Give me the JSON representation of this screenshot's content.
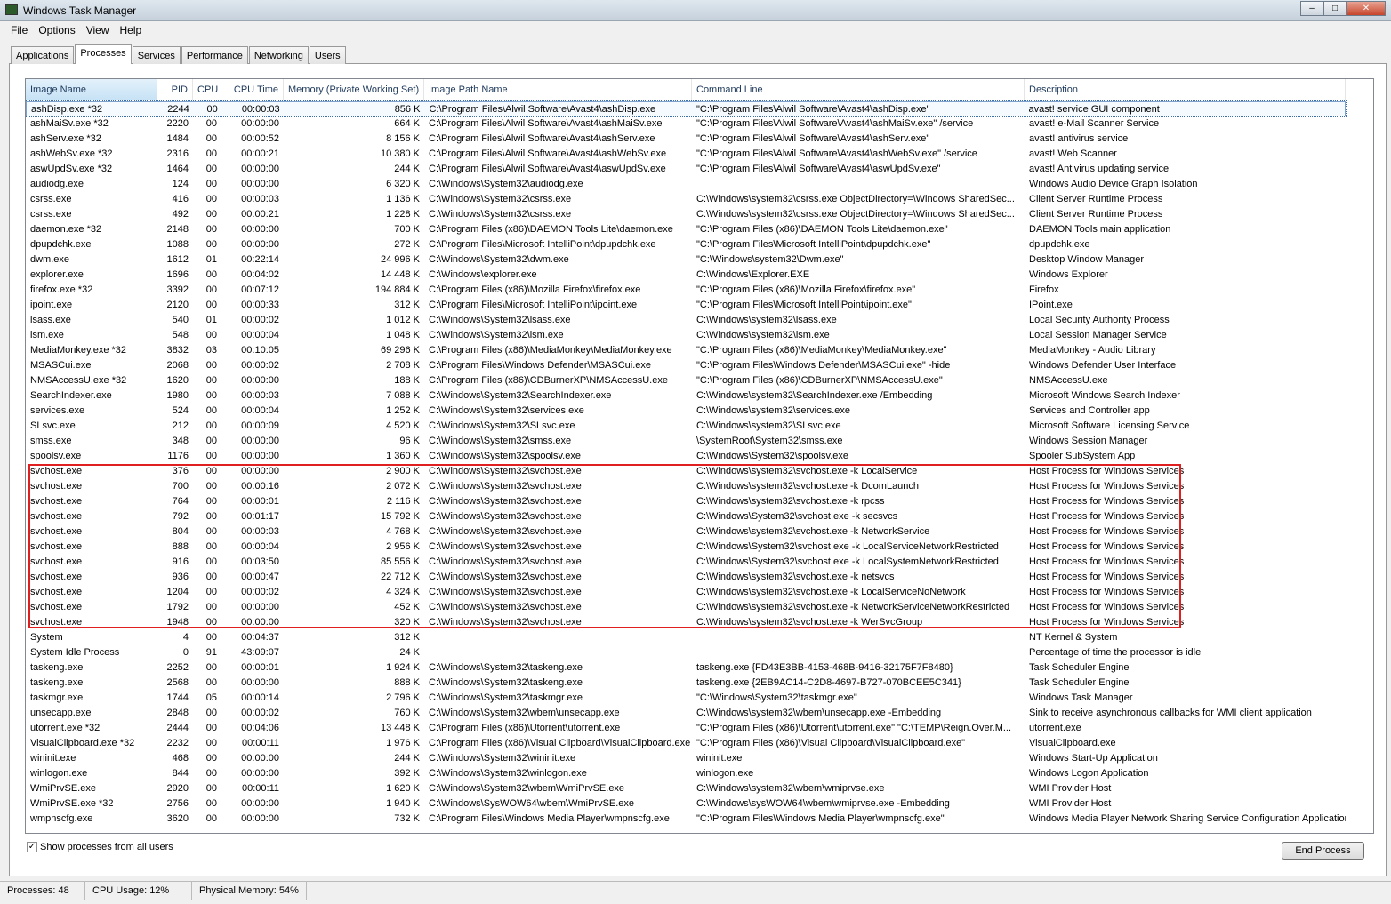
{
  "window": {
    "title": "Windows Task Manager"
  },
  "menu": [
    "File",
    "Options",
    "View",
    "Help"
  ],
  "tabs": [
    "Applications",
    "Processes",
    "Services",
    "Performance",
    "Networking",
    "Users"
  ],
  "columns": [
    "Image Name",
    "PID",
    "CPU",
    "CPU Time",
    "Memory (Private Working Set)",
    "Image Path Name",
    "Command Line",
    "Description"
  ],
  "rows": [
    [
      "ashDisp.exe *32",
      "2244",
      "00",
      "00:00:03",
      "856 K",
      "C:\\Program Files\\Alwil Software\\Avast4\\ashDisp.exe",
      "\"C:\\Program Files\\Alwil Software\\Avast4\\ashDisp.exe\"",
      "avast! service GUI component"
    ],
    [
      "ashMaiSv.exe *32",
      "2220",
      "00",
      "00:00:00",
      "664 K",
      "C:\\Program Files\\Alwil Software\\Avast4\\ashMaiSv.exe",
      "\"C:\\Program Files\\Alwil Software\\Avast4\\ashMaiSv.exe\" /service",
      "avast! e-Mail Scanner Service"
    ],
    [
      "ashServ.exe *32",
      "1484",
      "00",
      "00:00:52",
      "8 156 K",
      "C:\\Program Files\\Alwil Software\\Avast4\\ashServ.exe",
      "\"C:\\Program Files\\Alwil Software\\Avast4\\ashServ.exe\"",
      "avast! antivirus service"
    ],
    [
      "ashWebSv.exe *32",
      "2316",
      "00",
      "00:00:21",
      "10 380 K",
      "C:\\Program Files\\Alwil Software\\Avast4\\ashWebSv.exe",
      "\"C:\\Program Files\\Alwil Software\\Avast4\\ashWebSv.exe\" /service",
      "avast! Web Scanner"
    ],
    [
      "aswUpdSv.exe *32",
      "1464",
      "00",
      "00:00:00",
      "244 K",
      "C:\\Program Files\\Alwil Software\\Avast4\\aswUpdSv.exe",
      "\"C:\\Program Files\\Alwil Software\\Avast4\\aswUpdSv.exe\"",
      "avast! Antivirus updating service"
    ],
    [
      "audiodg.exe",
      "124",
      "00",
      "00:00:00",
      "6 320 K",
      "C:\\Windows\\System32\\audiodg.exe",
      "",
      "Windows Audio Device Graph Isolation"
    ],
    [
      "csrss.exe",
      "416",
      "00",
      "00:00:03",
      "1 136 K",
      "C:\\Windows\\System32\\csrss.exe",
      "C:\\Windows\\system32\\csrss.exe ObjectDirectory=\\Windows SharedSec...",
      "Client Server Runtime Process"
    ],
    [
      "csrss.exe",
      "492",
      "00",
      "00:00:21",
      "1 228 K",
      "C:\\Windows\\System32\\csrss.exe",
      "C:\\Windows\\system32\\csrss.exe ObjectDirectory=\\Windows SharedSec...",
      "Client Server Runtime Process"
    ],
    [
      "daemon.exe *32",
      "2148",
      "00",
      "00:00:00",
      "700 K",
      "C:\\Program Files (x86)\\DAEMON Tools Lite\\daemon.exe",
      "\"C:\\Program Files (x86)\\DAEMON Tools Lite\\daemon.exe\"",
      "DAEMON Tools main application"
    ],
    [
      "dpupdchk.exe",
      "1088",
      "00",
      "00:00:00",
      "272 K",
      "C:\\Program Files\\Microsoft IntelliPoint\\dpupdchk.exe",
      "\"C:\\Program Files\\Microsoft IntelliPoint\\dpupdchk.exe\"",
      "dpupdchk.exe"
    ],
    [
      "dwm.exe",
      "1612",
      "01",
      "00:22:14",
      "24 996 K",
      "C:\\Windows\\System32\\dwm.exe",
      "\"C:\\Windows\\system32\\Dwm.exe\"",
      "Desktop Window Manager"
    ],
    [
      "explorer.exe",
      "1696",
      "00",
      "00:04:02",
      "14 448 K",
      "C:\\Windows\\explorer.exe",
      "C:\\Windows\\Explorer.EXE",
      "Windows Explorer"
    ],
    [
      "firefox.exe *32",
      "3392",
      "00",
      "00:07:12",
      "194 884 K",
      "C:\\Program Files (x86)\\Mozilla Firefox\\firefox.exe",
      "\"C:\\Program Files (x86)\\Mozilla Firefox\\firefox.exe\"",
      "Firefox"
    ],
    [
      "ipoint.exe",
      "2120",
      "00",
      "00:00:33",
      "312 K",
      "C:\\Program Files\\Microsoft IntelliPoint\\ipoint.exe",
      "\"C:\\Program Files\\Microsoft IntelliPoint\\ipoint.exe\"",
      "IPoint.exe"
    ],
    [
      "lsass.exe",
      "540",
      "01",
      "00:00:02",
      "1 012 K",
      "C:\\Windows\\System32\\lsass.exe",
      "C:\\Windows\\system32\\lsass.exe",
      "Local Security Authority Process"
    ],
    [
      "lsm.exe",
      "548",
      "00",
      "00:00:04",
      "1 048 K",
      "C:\\Windows\\System32\\lsm.exe",
      "C:\\Windows\\system32\\lsm.exe",
      "Local Session Manager Service"
    ],
    [
      "MediaMonkey.exe *32",
      "3832",
      "03",
      "00:10:05",
      "69 296 K",
      "C:\\Program Files (x86)\\MediaMonkey\\MediaMonkey.exe",
      "\"C:\\Program Files (x86)\\MediaMonkey\\MediaMonkey.exe\"",
      "MediaMonkey - Audio Library"
    ],
    [
      "MSASCui.exe",
      "2068",
      "00",
      "00:00:02",
      "2 708 K",
      "C:\\Program Files\\Windows Defender\\MSASCui.exe",
      "\"C:\\Program Files\\Windows Defender\\MSASCui.exe\" -hide",
      "Windows Defender User Interface"
    ],
    [
      "NMSAccessU.exe *32",
      "1620",
      "00",
      "00:00:00",
      "188 K",
      "C:\\Program Files (x86)\\CDBurnerXP\\NMSAccessU.exe",
      "\"C:\\Program Files (x86)\\CDBurnerXP\\NMSAccessU.exe\"",
      "NMSAccessU.exe"
    ],
    [
      "SearchIndexer.exe",
      "1980",
      "00",
      "00:00:03",
      "7 088 K",
      "C:\\Windows\\System32\\SearchIndexer.exe",
      "C:\\Windows\\system32\\SearchIndexer.exe /Embedding",
      "Microsoft Windows Search Indexer"
    ],
    [
      "services.exe",
      "524",
      "00",
      "00:00:04",
      "1 252 K",
      "C:\\Windows\\System32\\services.exe",
      "C:\\Windows\\system32\\services.exe",
      "Services and Controller app"
    ],
    [
      "SLsvc.exe",
      "212",
      "00",
      "00:00:09",
      "4 520 K",
      "C:\\Windows\\System32\\SLsvc.exe",
      "C:\\Windows\\system32\\SLsvc.exe",
      "Microsoft Software Licensing Service"
    ],
    [
      "smss.exe",
      "348",
      "00",
      "00:00:00",
      "96 K",
      "C:\\Windows\\System32\\smss.exe",
      "\\SystemRoot\\System32\\smss.exe",
      "Windows Session Manager"
    ],
    [
      "spoolsv.exe",
      "1176",
      "00",
      "00:00:00",
      "1 360 K",
      "C:\\Windows\\System32\\spoolsv.exe",
      "C:\\Windows\\System32\\spoolsv.exe",
      "Spooler SubSystem App"
    ],
    [
      "svchost.exe",
      "376",
      "00",
      "00:00:00",
      "2 900 K",
      "C:\\Windows\\System32\\svchost.exe",
      "C:\\Windows\\system32\\svchost.exe -k LocalService",
      "Host Process for Windows Services"
    ],
    [
      "svchost.exe",
      "700",
      "00",
      "00:00:16",
      "2 072 K",
      "C:\\Windows\\System32\\svchost.exe",
      "C:\\Windows\\system32\\svchost.exe -k DcomLaunch",
      "Host Process for Windows Services"
    ],
    [
      "svchost.exe",
      "764",
      "00",
      "00:00:01",
      "2 116 K",
      "C:\\Windows\\System32\\svchost.exe",
      "C:\\Windows\\system32\\svchost.exe -k rpcss",
      "Host Process for Windows Services"
    ],
    [
      "svchost.exe",
      "792",
      "00",
      "00:01:17",
      "15 792 K",
      "C:\\Windows\\System32\\svchost.exe",
      "C:\\Windows\\System32\\svchost.exe -k secsvcs",
      "Host Process for Windows Services"
    ],
    [
      "svchost.exe",
      "804",
      "00",
      "00:00:03",
      "4 768 K",
      "C:\\Windows\\System32\\svchost.exe",
      "C:\\Windows\\system32\\svchost.exe -k NetworkService",
      "Host Process for Windows Services"
    ],
    [
      "svchost.exe",
      "888",
      "00",
      "00:00:04",
      "2 956 K",
      "C:\\Windows\\System32\\svchost.exe",
      "C:\\Windows\\System32\\svchost.exe -k LocalServiceNetworkRestricted",
      "Host Process for Windows Services"
    ],
    [
      "svchost.exe",
      "916",
      "00",
      "00:03:50",
      "85 556 K",
      "C:\\Windows\\System32\\svchost.exe",
      "C:\\Windows\\System32\\svchost.exe -k LocalSystemNetworkRestricted",
      "Host Process for Windows Services"
    ],
    [
      "svchost.exe",
      "936",
      "00",
      "00:00:47",
      "22 712 K",
      "C:\\Windows\\System32\\svchost.exe",
      "C:\\Windows\\system32\\svchost.exe -k netsvcs",
      "Host Process for Windows Services"
    ],
    [
      "svchost.exe",
      "1204",
      "00",
      "00:00:02",
      "4 324 K",
      "C:\\Windows\\System32\\svchost.exe",
      "C:\\Windows\\system32\\svchost.exe -k LocalServiceNoNetwork",
      "Host Process for Windows Services"
    ],
    [
      "svchost.exe",
      "1792",
      "00",
      "00:00:00",
      "452 K",
      "C:\\Windows\\System32\\svchost.exe",
      "C:\\Windows\\system32\\svchost.exe -k NetworkServiceNetworkRestricted",
      "Host Process for Windows Services"
    ],
    [
      "svchost.exe",
      "1948",
      "00",
      "00:00:00",
      "320 K",
      "C:\\Windows\\System32\\svchost.exe",
      "C:\\Windows\\system32\\svchost.exe -k WerSvcGroup",
      "Host Process for Windows Services"
    ],
    [
      "System",
      "4",
      "00",
      "00:04:37",
      "312 K",
      "",
      "",
      "NT Kernel & System"
    ],
    [
      "System Idle Process",
      "0",
      "91",
      "43:09:07",
      "24 K",
      "",
      "",
      "Percentage of time the processor is idle"
    ],
    [
      "taskeng.exe",
      "2252",
      "00",
      "00:00:01",
      "1 924 K",
      "C:\\Windows\\System32\\taskeng.exe",
      "taskeng.exe {FD43E3BB-4153-468B-9416-32175F7F8480}",
      "Task Scheduler Engine"
    ],
    [
      "taskeng.exe",
      "2568",
      "00",
      "00:00:00",
      "888 K",
      "C:\\Windows\\System32\\taskeng.exe",
      "taskeng.exe {2EB9AC14-C2D8-4697-B727-070BCEE5C341}",
      "Task Scheduler Engine"
    ],
    [
      "taskmgr.exe",
      "1744",
      "05",
      "00:00:14",
      "2 796 K",
      "C:\\Windows\\System32\\taskmgr.exe",
      "\"C:\\Windows\\System32\\taskmgr.exe\"",
      "Windows Task Manager"
    ],
    [
      "unsecapp.exe",
      "2848",
      "00",
      "00:00:02",
      "760 K",
      "C:\\Windows\\System32\\wbem\\unsecapp.exe",
      "C:\\Windows\\system32\\wbem\\unsecapp.exe -Embedding",
      "Sink to receive asynchronous callbacks for WMI client application"
    ],
    [
      "utorrent.exe *32",
      "2444",
      "00",
      "00:04:06",
      "13 448 K",
      "C:\\Program Files (x86)\\Utorrent\\utorrent.exe",
      "\"C:\\Program Files (x86)\\Utorrent\\utorrent.exe\" \"C:\\TEMP\\Reign.Over.M...",
      "utorrent.exe"
    ],
    [
      "VisualClipboard.exe *32",
      "2232",
      "00",
      "00:00:11",
      "1 976 K",
      "C:\\Program Files (x86)\\Visual Clipboard\\VisualClipboard.exe",
      "\"C:\\Program Files (x86)\\Visual Clipboard\\VisualClipboard.exe\"",
      "VisualClipboard.exe"
    ],
    [
      "wininit.exe",
      "468",
      "00",
      "00:00:00",
      "244 K",
      "C:\\Windows\\System32\\wininit.exe",
      "wininit.exe",
      "Windows Start-Up Application"
    ],
    [
      "winlogon.exe",
      "844",
      "00",
      "00:00:00",
      "392 K",
      "C:\\Windows\\System32\\winlogon.exe",
      "winlogon.exe",
      "Windows Logon Application"
    ],
    [
      "WmiPrvSE.exe",
      "2920",
      "00",
      "00:00:11",
      "1 620 K",
      "C:\\Windows\\System32\\wbem\\WmiPrvSE.exe",
      "C:\\Windows\\system32\\wbem\\wmiprvse.exe",
      "WMI Provider Host"
    ],
    [
      "WmiPrvSE.exe *32",
      "2756",
      "00",
      "00:00:00",
      "1 940 K",
      "C:\\Windows\\SysWOW64\\wbem\\WmiPrvSE.exe",
      "C:\\Windows\\sysWOW64\\wbem\\wmiprvse.exe -Embedding",
      "WMI Provider Host"
    ],
    [
      "wmpnscfg.exe",
      "3620",
      "00",
      "00:00:00",
      "732 K",
      "C:\\Program Files\\Windows Media Player\\wmpnscfg.exe",
      "\"C:\\Program Files\\Windows Media Player\\wmpnscfg.exe\"",
      "Windows Media Player Network Sharing Service Configuration Application"
    ]
  ],
  "show_all_users": {
    "label": "Show processes from all users",
    "checked": true
  },
  "end_process": "End Process",
  "status": {
    "processes": "Processes: 48",
    "cpu": "CPU Usage: 12%",
    "memory": "Physical Memory: 54%"
  },
  "colors": {
    "highlight_box": "#e02020"
  }
}
